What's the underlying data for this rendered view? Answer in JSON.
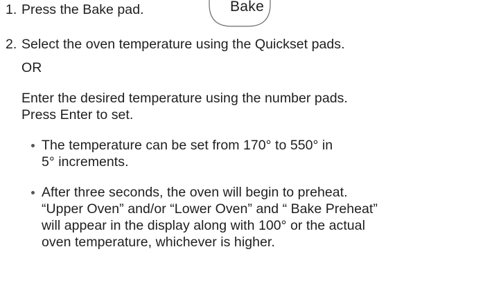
{
  "steps": [
    {
      "number": "1.",
      "text": "Press the Bake pad.",
      "pad_label": "Bake"
    },
    {
      "number": "2.",
      "text": "Select the oven temperature using the Quickset pads.",
      "or": "OR",
      "alt_line1": "Enter the desired temperature using the number pads.",
      "alt_line2": "Press Enter to set.",
      "bullets": [
        {
          "lines": [
            "The temperature can be set from 170° to 550° in",
            "5° increments."
          ]
        },
        {
          "lines": [
            "After three seconds, the oven will begin to preheat.",
            "“Upper Oven” and/or “Lower Oven” and “ Bake Preheat”",
            "will appear in the display along with 100° or the actual",
            "oven temperature, whichever is higher."
          ]
        }
      ]
    }
  ]
}
